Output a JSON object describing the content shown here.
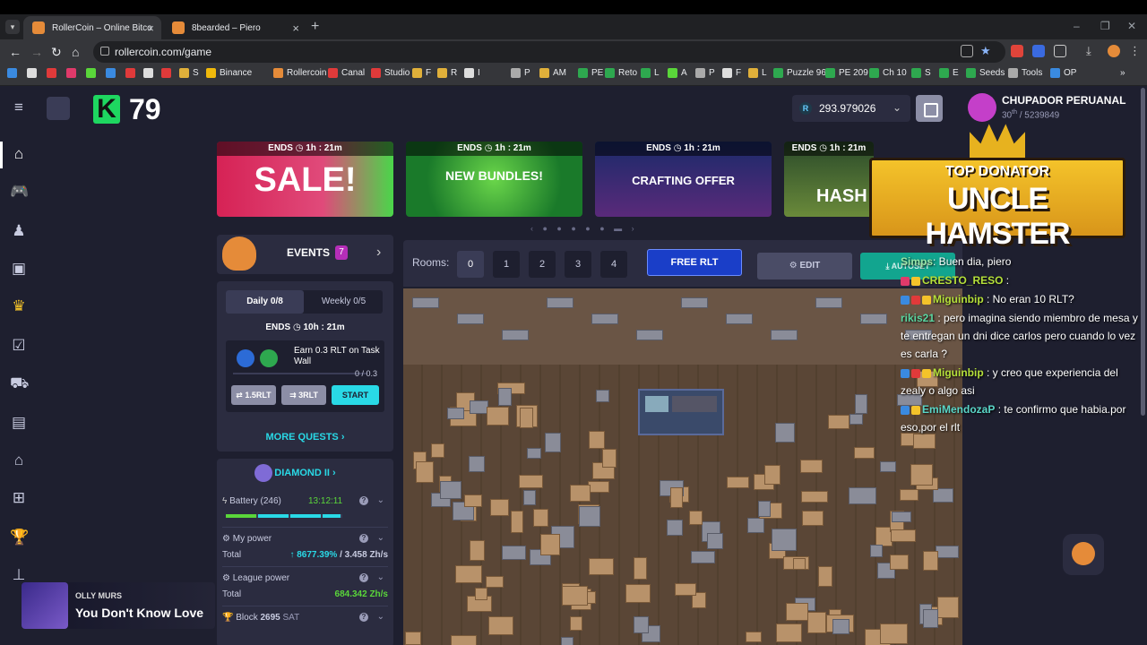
{
  "browser": {
    "tabs": [
      {
        "title": "RollerCoin – Online Bitcoin Mir",
        "active": true
      },
      {
        "title": "8bearded – Piero",
        "active": false
      }
    ],
    "url": "rollercoin.com/game",
    "bookmarks": [
      "S",
      "Binance",
      "Rollercoin",
      "Canal",
      "Studio",
      "F",
      "R",
      "I",
      "P",
      "AM",
      "PE",
      "Reto",
      "L",
      "A",
      "P",
      "F",
      "L",
      "Puzzle 96",
      "PE 209",
      "Ch 10",
      "S",
      "E",
      "Seeds",
      "Tools",
      "OP"
    ]
  },
  "header": {
    "level_number": "79",
    "balance": "293.979026",
    "balance_currency_icon": "R",
    "username": "CHUPADOR PERUANAL",
    "rank_prefix": "30",
    "rank_suffix": "th",
    "rank_total": "/ 5239849"
  },
  "banners": [
    {
      "ends_label": "ENDS",
      "timer": "1h : 21m",
      "text": "SALE!",
      "color": "#d62255"
    },
    {
      "ends_label": "ENDS",
      "timer": "1h : 21m",
      "text": "NEW BUNDLES!",
      "color": "#2ea83a"
    },
    {
      "ends_label": "ENDS",
      "timer": "1h : 21m",
      "text": "CRAFTING OFFER",
      "color": "#2a2a6a"
    },
    {
      "ends_label": "ENDS",
      "timer": "1h : 21m",
      "text": "HASH",
      "color": "#3a5a2a"
    }
  ],
  "events": {
    "title": "EVENTS",
    "count": "7"
  },
  "quests": {
    "tab_daily": "Daily",
    "tab_daily_count": "0/8",
    "tab_weekly": "Weekly",
    "tab_weekly_count": "0/5",
    "ends_label": "ENDS",
    "timer": "10h : 21m",
    "quest_text": "Earn 0.3 RLT on Task Wall",
    "quest_progress": "0 / 0.3",
    "btn_1": "⇄ 1.5RLT",
    "btn_2": "⇉ 3RLT",
    "btn_start": "START",
    "more_quests": "MORE QUESTS"
  },
  "stats": {
    "league": "DIAMOND II",
    "battery_label": "Battery (246)",
    "battery_time": "13:12:11",
    "my_power_label": "My power",
    "total_label": "Total",
    "my_power_pct": "↑ 8677.39%",
    "my_power_sep": "/",
    "my_power_value": "3.458 Zh/s",
    "league_power_label": "League power",
    "league_total_label": "Total",
    "league_power_value": "684.342 Zh/s",
    "block_label": "Block",
    "block_number": "2695",
    "block_currency": "SAT"
  },
  "game": {
    "rooms_label": "Rooms:",
    "rooms": [
      "0",
      "1",
      "2",
      "3",
      "4"
    ],
    "active_room": 0,
    "free_rlt": "FREE RLT",
    "edit": "EDIT",
    "autoset": "AUTOSET"
  },
  "overlay": {
    "donator_title": "TOP DONATOR",
    "donator_name": "UNCLE HAMSTER",
    "chat": [
      {
        "name": "Simps",
        "text": ": Buen dia, piero",
        "color": "#9ae6a8"
      },
      {
        "name": "CRESTO_RESO",
        "text": " :",
        "color": "#b5e03a"
      },
      {
        "name": "Miguinbip",
        "text": " : No eran 10 RLT?",
        "color": "#b5e03a"
      },
      {
        "name": "rikis21",
        "text": " : pero imagina siendo miembro de mesa y te entregan un dni dice carlos pero cuando lo vez es carla ?",
        "color": "#5ad6a0"
      },
      {
        "name": "Miguinbip",
        "text": " : y creo que experiencia del zealy o algo asi",
        "color": "#b5e03a"
      },
      {
        "name": "EmiMendozaP",
        "text": " : te confirmo que habia.por eso,por el rlt",
        "color": "#5ad6c8"
      }
    ],
    "music_artist": "OLLY MURS",
    "music_song": "You Don't Know Love"
  }
}
